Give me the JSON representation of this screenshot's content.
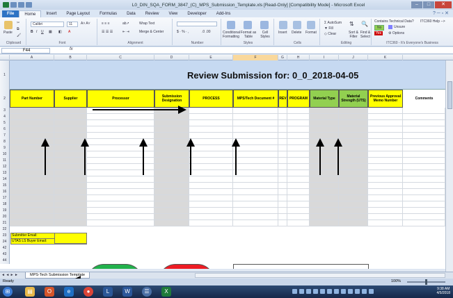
{
  "window": {
    "title": "L0_DIN_SQA_FORM_3847_(C)_MPS_Submission_Template.xls [Read-Only] [Compatibility Mode] - Microsoft Excel",
    "min": "–",
    "max": "□",
    "close": "✕"
  },
  "ribbon_tabs": [
    "File",
    "Home",
    "Insert",
    "Page Layout",
    "Formulas",
    "Data",
    "Review",
    "View",
    "Developer",
    "Add-Ins"
  ],
  "ribbon": {
    "paste": "Paste",
    "clipboard": "Clipboard",
    "font_name": "Calibri",
    "font_size": "11",
    "font": "Font",
    "wrap_text": "Wrap Text",
    "merge_center": "Merge & Center",
    "alignment": "Alignment",
    "number": "Number",
    "cond_format": "Conditional Formatting",
    "format_table": "Format as Table",
    "cell_styles": "Cell Styles",
    "styles": "Styles",
    "insert": "Insert",
    "delete": "Delete",
    "format": "Format",
    "cells": "Cells",
    "autosum": "AutoSum",
    "fill": "Fill",
    "clear": "Clear",
    "sort_filter": "Sort & Filter",
    "find_select": "Find & Select",
    "editing": "Editing",
    "itc_title": "Contains Technical Data?",
    "itc_help": "ITC360 Help -->",
    "itc_no": "No",
    "itc_unsure": "Unsure",
    "itc_yes": "Yes",
    "itc_options": "Options",
    "itc_footer": "ITC360 - It's Everyone's Business"
  },
  "formula_bar": {
    "name_box": "F44",
    "fx": "fx",
    "value": ""
  },
  "columns": [
    "A",
    "B",
    "C",
    "D",
    "E",
    "F",
    "G",
    "H",
    "I",
    "J",
    "K"
  ],
  "sheet": {
    "banner": "Review Submission for: 0_0_2018-04-05",
    "headers": [
      "Part Number",
      "Supplier",
      "Processor",
      "Submission Designation",
      "PROCESS",
      "MPS/Tech Document #",
      "REV",
      "PROGRAM",
      "Material Type",
      "Material Strength (UTS)",
      "Previous Approval Memo Number",
      "Comments"
    ],
    "row_numbers": [
      "1",
      "2",
      "3",
      "4",
      "5",
      "6",
      "7",
      "8",
      "9",
      "10",
      "11",
      "12",
      "13",
      "14",
      "15",
      "16",
      "17",
      "18",
      "19",
      "20",
      "21",
      "22",
      "23",
      "24",
      "42",
      "43",
      "44"
    ],
    "submitter_email": "Submitter Email:",
    "buyer_email": "UTAS LS Buyer Email:"
  },
  "sheet_tab": "MPS-Tech Submission Template",
  "nav": "◄ ◄ ► ►",
  "status": {
    "ready": "Ready",
    "zoom": "100%"
  },
  "clock": {
    "time": "9:38 AM",
    "date": "4/5/2018"
  },
  "colors": {
    "yellow": "#ffff00",
    "green": "#92d050",
    "banner": "#c6d9f1",
    "gray": "#d9d9d9"
  }
}
